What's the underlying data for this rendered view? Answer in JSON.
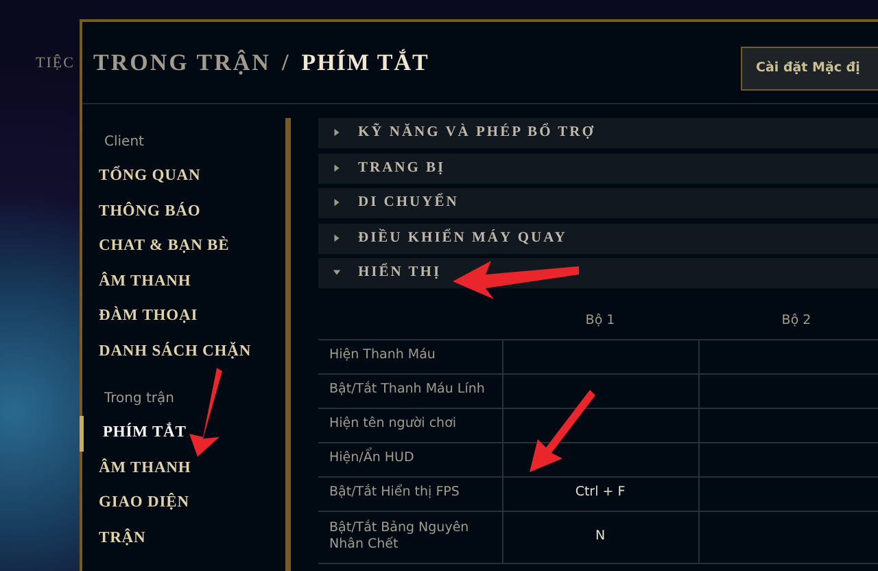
{
  "background": {
    "label": "TIỆC"
  },
  "header": {
    "path": "TRONG TRẬN",
    "separator": "/",
    "title": "PHÍM TẮT",
    "button": "Cài đặt Mặc đị"
  },
  "sidebar": {
    "groups": [
      {
        "label": "Client",
        "items": [
          {
            "label": "TỔNG QUAN",
            "selected": false
          },
          {
            "label": "THÔNG BÁO",
            "selected": false
          },
          {
            "label": "CHAT & BẠN BÈ",
            "selected": false
          },
          {
            "label": "ÂM THANH",
            "selected": false
          },
          {
            "label": "ĐÀM THOẠI",
            "selected": false
          },
          {
            "label": "DANH SÁCH CHẶN",
            "selected": false
          }
        ]
      },
      {
        "label": "Trong trận",
        "items": [
          {
            "label": "PHÍM TẮT",
            "selected": true
          },
          {
            "label": "ÂM THANH",
            "selected": false
          },
          {
            "label": "GIAO DIỆN",
            "selected": false
          },
          {
            "label": "TRẬN",
            "selected": false
          }
        ]
      }
    ]
  },
  "sections": [
    {
      "label": "KỸ NĂNG VÀ PHÉP BỔ TRỢ",
      "expanded": false
    },
    {
      "label": "TRANG BỊ",
      "expanded": false
    },
    {
      "label": "DI CHUYỂN",
      "expanded": false
    },
    {
      "label": "ĐIỀU KHIỂN MÁY QUAY",
      "expanded": false
    },
    {
      "label": "HIỂN THỊ",
      "expanded": true
    }
  ],
  "table": {
    "columns": [
      "Bộ 1",
      "Bộ 2"
    ],
    "rows": [
      {
        "action": "Hiện Thanh Máu",
        "set_1": "",
        "set_2": ""
      },
      {
        "action": "Bật/Tắt Thanh Máu Lính",
        "set_1": "",
        "set_2": ""
      },
      {
        "action": "Hiện tên người chơi",
        "set_1": "",
        "set_2": ""
      },
      {
        "action": "Hiện/Ẩn HUD",
        "set_1": "",
        "set_2": ""
      },
      {
        "action": "Bật/Tắt Hiển thị FPS",
        "set_1": "Ctrl + F",
        "set_2": ""
      },
      {
        "action": "Bật/Tắt Bảng Nguyên Nhân Chết",
        "set_1": "N",
        "set_2": ""
      }
    ]
  }
}
